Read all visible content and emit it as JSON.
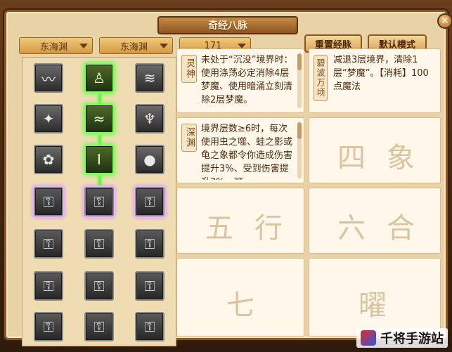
{
  "window": {
    "title": "奇经八脉",
    "close_label": "✕"
  },
  "filters": {
    "dropdown1": "东海渊",
    "dropdown2": "东海渊",
    "dropdown3": "171"
  },
  "buttons": {
    "reset": "重置经脉",
    "default_mode": "默认模式"
  },
  "grid": {
    "rows": [
      [
        "wave-icon",
        "figure-icon",
        "stream-icon"
      ],
      [
        "bird-icon",
        "wind-icon",
        "dragon-icon"
      ],
      [
        "lotus-icon",
        "pillar-icon",
        "gourd-icon"
      ],
      [
        "lock-icon",
        "lock-icon",
        "lock-icon"
      ],
      [
        "lock-icon",
        "lock-icon",
        "lock-icon"
      ],
      [
        "lock-icon",
        "lock-icon",
        "lock-icon"
      ],
      [
        "lock-icon",
        "lock-icon",
        "lock-icon"
      ]
    ],
    "active_cells": [
      "0-1",
      "1-1",
      "2-1"
    ]
  },
  "skills": [
    {
      "name": "灵神",
      "text": "未处于“沉没”境界时：使用涤荡必定消除4层梦魔、使用暗涌立刻清除2层梦魔。"
    },
    {
      "name": "碧波万顷",
      "text": "减退3层境界，清除1层“梦魔”。【消耗】100点魔法"
    },
    {
      "name": "深渊",
      "text": "境界层数≥6时，每次使用虫之噬、蛙之影或龟之象都令你造成伤害提升3%、受到伤害提升3%，可"
    }
  ],
  "decor_glyphs": [
    "四",
    "象",
    "五",
    "行",
    "六",
    "合",
    "七",
    "曜"
  ],
  "watermark": {
    "text": "千将手游站"
  },
  "colors": {
    "active_glow": "#7cff5a",
    "panel_bg": "#e9d2a6",
    "text": "#4a2a10"
  }
}
